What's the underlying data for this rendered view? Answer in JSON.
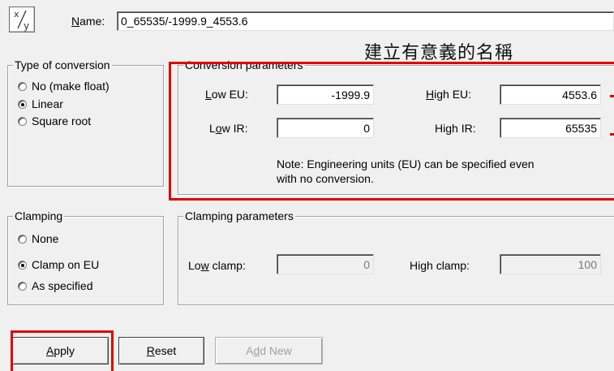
{
  "name_row": {
    "label_mnemonic": "N",
    "label_rest": "ame:",
    "value": "0_65535/-1999.9_4553.6"
  },
  "annotation_text": "建立有意義的名稱",
  "type_group": {
    "legend_mnemonic": "T",
    "legend_rest": "ype of conversion",
    "options": [
      {
        "label": "No (make float)",
        "checked": false
      },
      {
        "label": "Linear",
        "checked": true
      },
      {
        "label": "Square root",
        "checked": false
      }
    ]
  },
  "conversion_group": {
    "legend": "Conversion parameters",
    "low_eu_label_mnemonic": "L",
    "low_eu_label_rest": "ow EU:",
    "low_eu_value": "-1999.9",
    "high_eu_label_mnemonic": "H",
    "high_eu_label_rest": "igh EU:",
    "high_eu_value": "4553.6",
    "low_ir_label_pre": "L",
    "low_ir_label_mnemonic": "o",
    "low_ir_label_rest": "w IR:",
    "low_ir_value": "0",
    "high_ir_label_pre": "Hi",
    "high_ir_label_mnemonic": "g",
    "high_ir_label_rest": "h IR:",
    "high_ir_value": "65535",
    "note_line1": "Note: Engineering units (EU) can be specified even",
    "note_line2": "with no conversion."
  },
  "clamping_group": {
    "legend_mnemonic": "C",
    "legend_rest": "lamping",
    "options": [
      {
        "label": "None",
        "checked": false
      },
      {
        "label": "Clamp on EU",
        "checked": true
      },
      {
        "label": "As specified",
        "checked": false
      }
    ]
  },
  "clamp_params_group": {
    "legend": "Clamping parameters",
    "low_clamp_label_pre": "Lo",
    "low_clamp_label_mnemonic": "w",
    "low_clamp_label_rest": " clamp:",
    "low_clamp_value": "0",
    "high_clamp_label_pre": "Hi",
    "high_clamp_label_mnemonic": "g",
    "high_clamp_label_rest": "h clamp:",
    "high_clamp_value": "100"
  },
  "buttons": {
    "apply_mnemonic": "A",
    "apply_rest": "pply",
    "reset_mnemonic": "R",
    "reset_rest": "eset",
    "add_new_pre": "A",
    "add_new_mnemonic": "d",
    "add_new_rest": "d New"
  },
  "colors": {
    "highlight": "#e00000",
    "window_bg": "#f0f0f0"
  }
}
